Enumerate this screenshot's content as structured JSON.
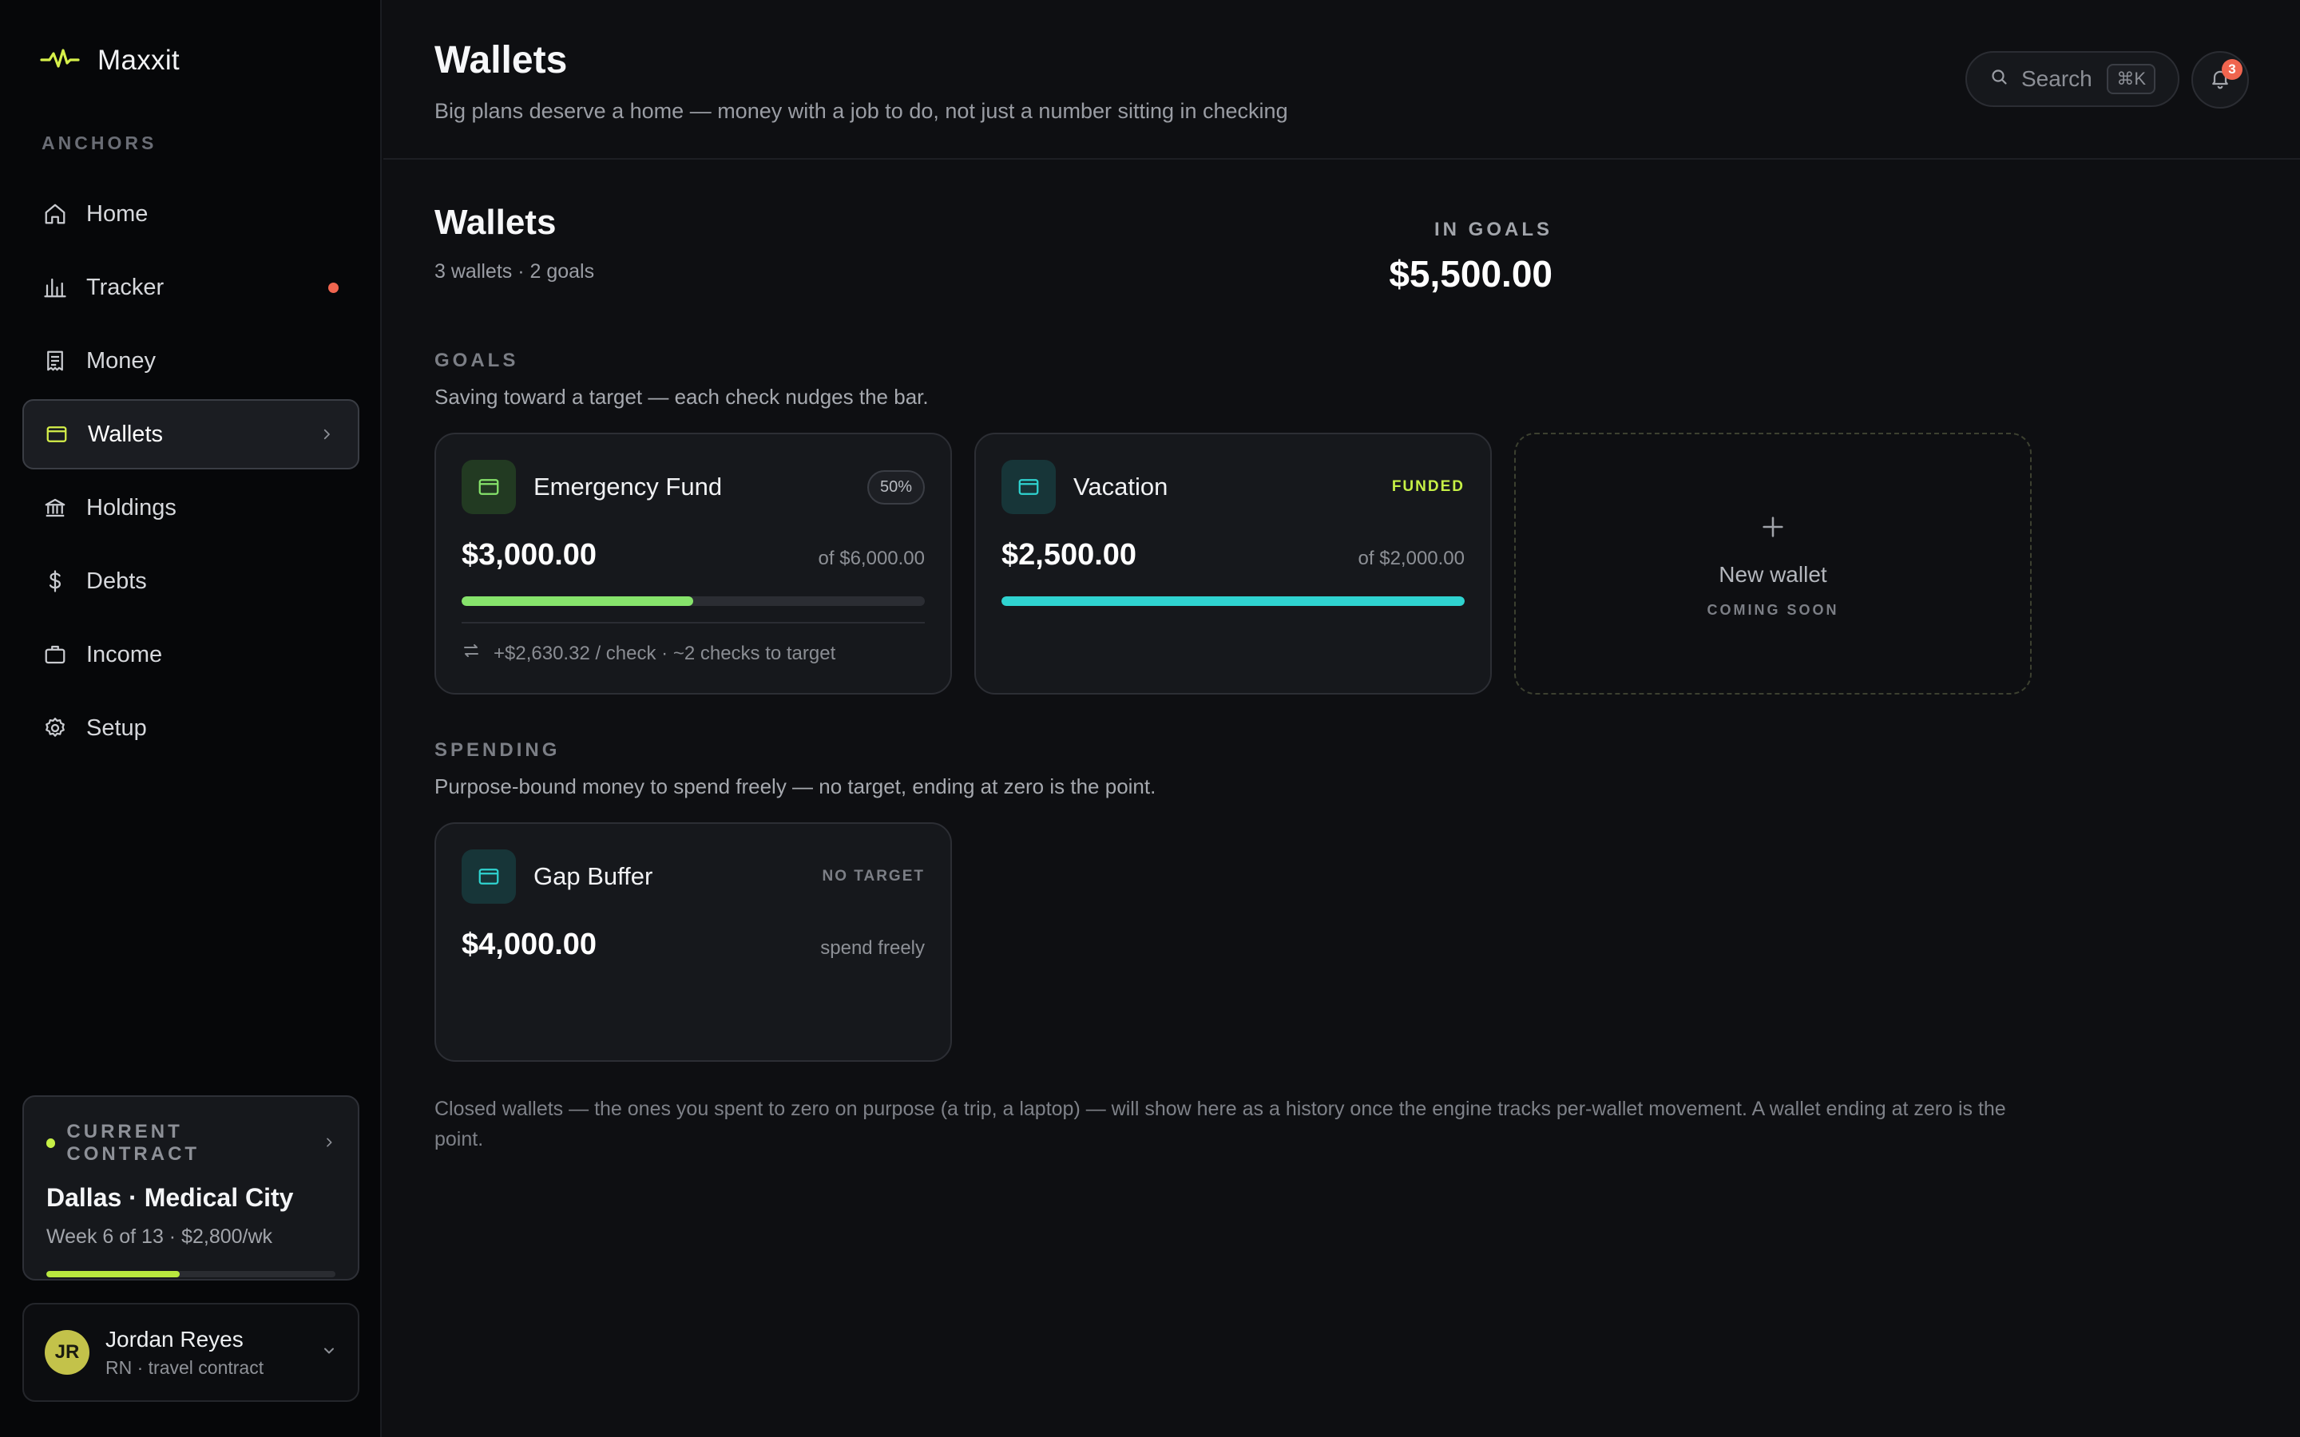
{
  "app": {
    "name": "Maxxit"
  },
  "sidebar": {
    "section_label": "ANCHORS",
    "items": [
      {
        "label": "Home",
        "icon": "home-icon"
      },
      {
        "label": "Tracker",
        "icon": "bar-chart-icon",
        "has_alert": true
      },
      {
        "label": "Money",
        "icon": "receipt-icon"
      },
      {
        "label": "Wallets",
        "icon": "wallet-icon",
        "active": true
      },
      {
        "label": "Holdings",
        "icon": "bank-icon"
      },
      {
        "label": "Debts",
        "icon": "dollar-icon"
      },
      {
        "label": "Income",
        "icon": "briefcase-icon"
      },
      {
        "label": "Setup",
        "icon": "gear-icon"
      }
    ],
    "contract": {
      "label": "CURRENT CONTRACT",
      "title": "Dallas · Medical City",
      "subtitle": "Week 6 of 13 · $2,800/wk",
      "progress": 0.46
    },
    "user": {
      "initials": "JR",
      "name": "Jordan Reyes",
      "role": "RN · travel contract"
    }
  },
  "header": {
    "title": "Wallets",
    "subtitle": "Big plans deserve a home — money with a job to do, not just a number sitting in checking",
    "search_placeholder": "Search",
    "search_shortcut": "⌘K",
    "notification_count": "3"
  },
  "main": {
    "title": "Wallets",
    "summary": "3 wallets · 2 goals",
    "goals_total_label": "IN GOALS",
    "goals_total": "$5,500.00",
    "goals": {
      "label": "GOALS",
      "description": "Saving toward a target — each check nudges the bar.",
      "cards": [
        {
          "name": "Emergency Fund",
          "tag": "50%",
          "amount": "$3,000.00",
          "target": "of $6,000.00",
          "progress": 0.5,
          "color": "#86e36b",
          "footer": "+$2,630.32 / check · ~2 checks to target"
        },
        {
          "name": "Vacation",
          "tag": "FUNDED",
          "amount": "$2,500.00",
          "target": "of $2,000.00",
          "progress": 1.0,
          "color": "#2fd3d0"
        }
      ],
      "new_wallet": {
        "label": "New wallet",
        "note": "COMING SOON"
      }
    },
    "spending": {
      "label": "SPENDING",
      "description": "Purpose-bound money to spend freely — no target, ending at zero is the point.",
      "cards": [
        {
          "name": "Gap Buffer",
          "tag": "NO TARGET",
          "amount": "$4,000.00",
          "note": "spend freely"
        }
      ]
    },
    "footnote": "Closed wallets — the ones you spent to zero on purpose (a trip, a laptop) — will show here as a history once the engine tracks per-wallet movement. A wallet ending at zero is the point."
  },
  "colors": {
    "accent": "#c6f046",
    "alert": "#f0654f",
    "goal_green": "#86e36b",
    "goal_teal": "#2fd3d0"
  }
}
